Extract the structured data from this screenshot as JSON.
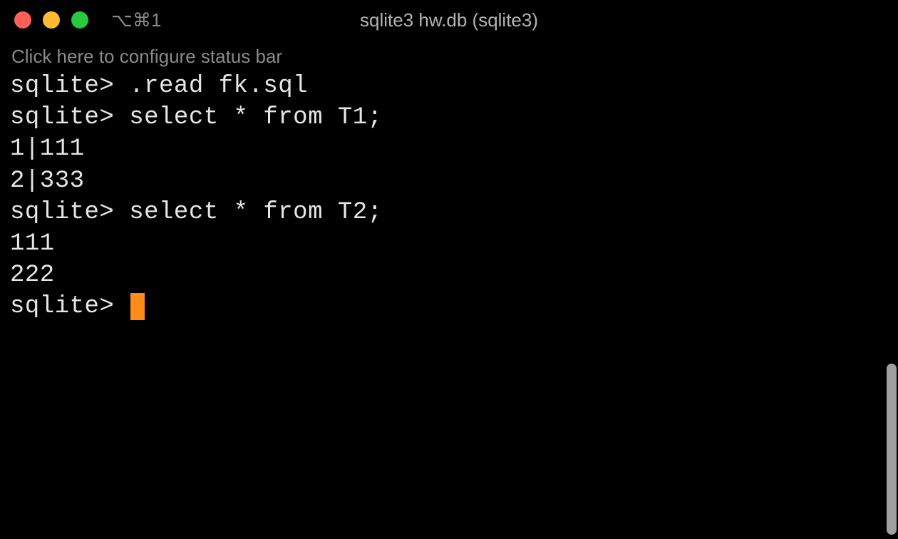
{
  "titlebar": {
    "tab_indicator": "⌥⌘1",
    "window_title": "sqlite3 hw.db (sqlite3)"
  },
  "status_bar": {
    "text": "Click here to configure status bar"
  },
  "terminal": {
    "lines": [
      "sqlite> .read fk.sql",
      "sqlite> select * from T1;",
      "1|111",
      "2|333",
      "sqlite> select * from T2;",
      "111",
      "222"
    ],
    "prompt": "sqlite> "
  }
}
